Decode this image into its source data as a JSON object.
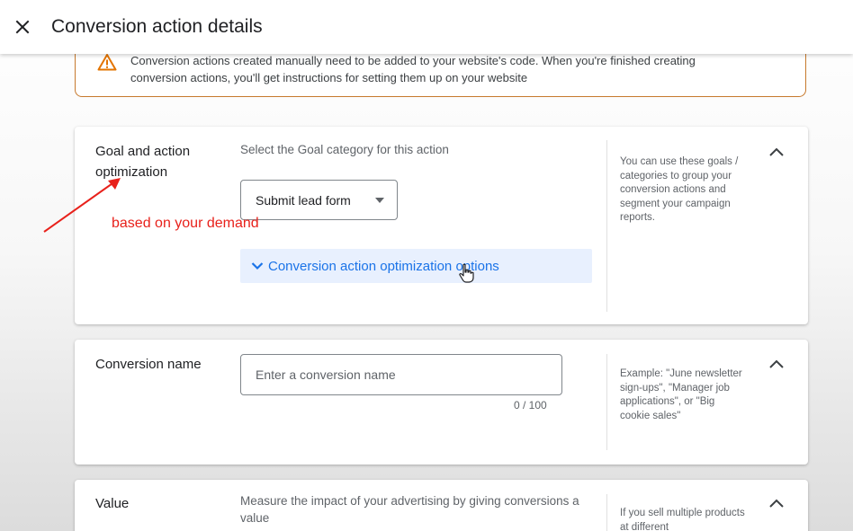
{
  "header": {
    "title": "Conversion action details",
    "close_icon": "close-icon"
  },
  "warning": {
    "icon": "warning-triangle-icon",
    "text": "Conversion actions created manually need to be added to your website's code. When you're finished creating conversion actions, you'll get instructions for setting them up on your website"
  },
  "goal_card": {
    "title": "Goal and action optimization",
    "description": "Select the Goal category for this action",
    "dropdown": {
      "selected": "Submit lead form",
      "icon": "dropdown-arrow-icon"
    },
    "optimization_options_label": "Conversion action optimization options",
    "help": "You can use these goals / categories to group your conversion actions and segment your campaign reports."
  },
  "name_card": {
    "title": "Conversion name",
    "input_value": "",
    "input_placeholder": "Enter a conversion name",
    "char_counter": "0 / 100",
    "help": "Example: \"June newsletter sign-ups\", \"Manager job applications\", or \"Big cookie sales\""
  },
  "value_card": {
    "title": "Value",
    "description": "Measure the impact of your advertising by giving conversions a value",
    "help": "If you sell multiple products at different"
  },
  "annotation": {
    "text": "based on your demand",
    "color": "#e8211b"
  },
  "colors": {
    "accent": "#1a73e8",
    "accent_bg": "#e8f0fe",
    "warning_border": "#c77a2e",
    "warning_icon": "#e37400"
  }
}
